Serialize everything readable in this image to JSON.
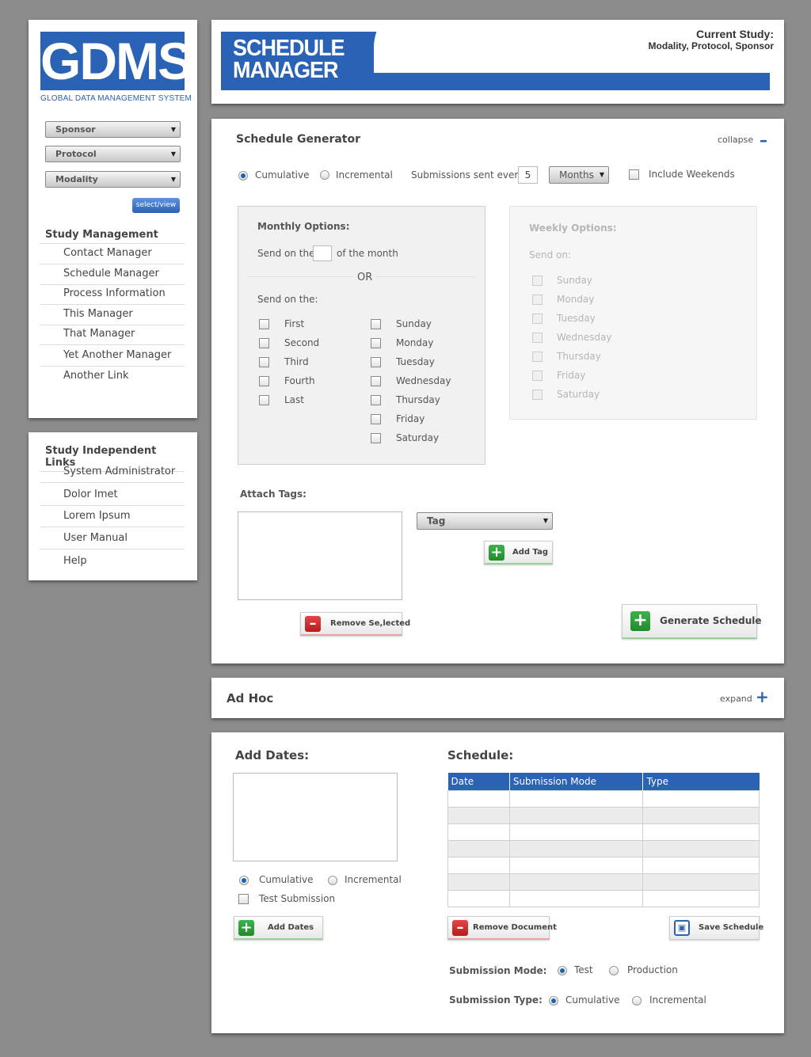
{
  "brand": {
    "logo": "GDMS",
    "tagline": "GLOBAL DATA MANAGEMENT SYSTEM"
  },
  "selectors": {
    "sponsor": "Sponsor",
    "protocol": "Protocol",
    "modality": "Modality",
    "select_view": "select/view"
  },
  "study_management": {
    "heading": "Study Management",
    "items": [
      "Contact Manager",
      "Schedule Manager",
      "Process Information",
      "This Manager",
      "That Manager",
      "Yet Another Manager",
      "Another Link"
    ]
  },
  "independent_links": {
    "heading": "Study Independent Links",
    "items": [
      "System Administrator",
      "Dolor Imet",
      "Lorem Ipsum",
      "User Manual",
      "Help"
    ]
  },
  "header": {
    "title_line1": "SCHEDULE",
    "title_line2": "MANAGER",
    "current_label": "Current Study:",
    "current_value": "Modality, Protocol, Sponsor"
  },
  "generator": {
    "title": "Schedule Generator",
    "collapse": "collapse",
    "cumulative": "Cumulative",
    "incremental": "Incremental",
    "sent_every": "Submissions sent every:",
    "interval_value": "5",
    "interval_unit": "Months",
    "include_weekends": "Include Weekends",
    "monthly": {
      "title": "Monthly Options:",
      "send_on_the": "Send on the",
      "of_the_month": "of the month",
      "or": "OR",
      "send_on_the2": "Send on the:",
      "ordinals": [
        "First",
        "Second",
        "Third",
        "Fourth",
        "Last"
      ],
      "days": [
        "Sunday",
        "Monday",
        "Tuesday",
        "Wednesday",
        "Thursday",
        "Friday",
        "Saturday"
      ]
    },
    "weekly": {
      "title": "Weekly Options:",
      "send_on": "Send on:",
      "days": [
        "Sunday",
        "Monday",
        "Tuesday",
        "Wednesday",
        "Thursday",
        "Friday",
        "Saturday"
      ]
    },
    "attach_tags": "Attach Tags:",
    "tag_select": "Tag",
    "add_tag": "Add Tag",
    "remove_selected": "Remove Se,lected",
    "generate": "Generate Schedule"
  },
  "adhoc": {
    "title": "Ad Hoc",
    "expand": "expand"
  },
  "dates": {
    "title": "Add Dates:",
    "cumulative": "Cumulative",
    "incremental": "Incremental",
    "test_submission": "Test Submission",
    "add_dates": "Add Dates"
  },
  "schedule": {
    "title": "Schedule:",
    "columns": [
      "Date",
      "Submission Mode",
      "Type"
    ],
    "remove_document": "Remove Document",
    "save_schedule": "Save Schedule",
    "mode_label": "Submission Mode:",
    "mode_test": "Test",
    "mode_production": "Production",
    "type_label": "Submission Type:",
    "type_cumulative": "Cumulative",
    "type_incremental": "Incremental"
  },
  "colors": {
    "brand_blue": "#2a63b5",
    "background": "#8c8c8c"
  },
  "icons": [
    "caret-down-icon",
    "plus-icon",
    "minus-icon",
    "save-disk-icon"
  ]
}
